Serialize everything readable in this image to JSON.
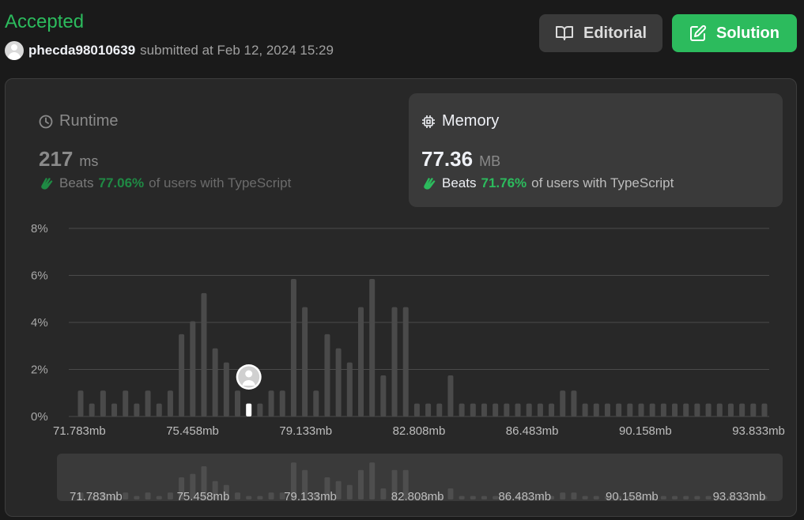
{
  "header": {
    "status": "Accepted",
    "username": "phecda98010639",
    "submitted_text": "submitted at Feb 12, 2024 15:29",
    "editorial_label": "Editorial",
    "solution_label": "Solution",
    "accent_color": "#2cbb5d"
  },
  "runtime": {
    "title": "Runtime",
    "value": "217",
    "unit": "ms",
    "beats_label": "Beats",
    "beats_pct": "77.06%",
    "beats_suffix": "of users with TypeScript",
    "icon": "clock-icon"
  },
  "memory": {
    "title": "Memory",
    "value": "77.36",
    "unit": "MB",
    "beats_label": "Beats",
    "beats_pct": "71.76%",
    "beats_suffix": "of users with TypeScript",
    "icon": "chip-icon"
  },
  "chart_data": {
    "type": "bar",
    "title": "",
    "xlabel": "",
    "ylabel": "",
    "ylim": [
      0,
      8
    ],
    "y_ticks": [
      "0%",
      "2%",
      "4%",
      "6%",
      "8%"
    ],
    "x_ticks": [
      "71.783mb",
      "75.458mb",
      "79.133mb",
      "82.808mb",
      "86.483mb",
      "90.158mb",
      "93.833mb"
    ],
    "values": [
      1.1,
      0.55,
      1.1,
      0.55,
      1.1,
      0.55,
      1.1,
      0.55,
      1.1,
      3.5,
      4.05,
      5.25,
      2.9,
      2.3,
      1.1,
      0.55,
      0.55,
      1.1,
      1.1,
      5.85,
      4.65,
      1.1,
      3.5,
      2.9,
      2.3,
      4.65,
      5.85,
      1.75,
      4.65,
      4.65,
      0.55,
      0.55,
      0.55,
      1.75,
      0.55,
      0.55,
      0.55,
      0.55,
      0.55,
      0.55,
      0.55,
      0.55,
      0.55,
      1.1,
      1.1,
      0.55,
      0.55,
      0.55,
      0.55,
      0.55,
      0.55,
      0.55,
      0.55,
      0.55,
      0.55,
      0.55,
      0.55,
      0.55,
      0.55,
      0.55,
      0.55,
      0.55
    ],
    "highlight_index": 15,
    "grid": true,
    "bar_color": "#4a4a4a",
    "highlight_color": "#ffffff",
    "grid_color": "#4a4a4a"
  },
  "minimap": {
    "x_ticks": [
      "71.783mb",
      "75.458mb",
      "79.133mb",
      "82.808mb",
      "86.483mb",
      "90.158mb",
      "93.833mb"
    ]
  }
}
